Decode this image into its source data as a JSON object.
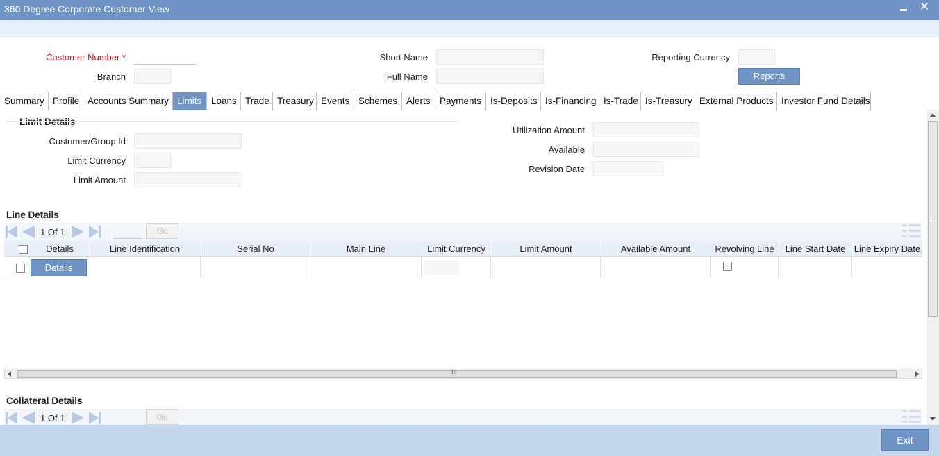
{
  "window": {
    "title": "360 Degree Corporate Customer View",
    "minimize_icon": "minimize-icon",
    "close_icon": "close-icon",
    "close_glyph": "✕"
  },
  "header": {
    "customer_number_label": "Customer Number",
    "required_mark": "*",
    "customer_number_value": "",
    "branch_label": "Branch",
    "branch_value": "",
    "short_name_label": "Short Name",
    "short_name_value": "",
    "full_name_label": "Full Name",
    "full_name_value": "",
    "reporting_currency_label": "Reporting Currency",
    "reporting_currency_value": "",
    "reports_button": "Reports"
  },
  "tabs": [
    "Summary",
    "Profile",
    "Accounts Summary",
    "Limits",
    "Loans",
    "Trade",
    "Treasury",
    "Events",
    "Schemes",
    "Alerts",
    "Payments",
    "Is-Deposits",
    "Is-Financing",
    "Is-Trade",
    "Is-Treasury",
    "External Products",
    "Investor Fund Details"
  ],
  "active_tab": "Limits",
  "limit_details": {
    "title": "Limit Details",
    "customer_group_id_label": "Customer/Group Id",
    "limit_currency_label": "Limit Currency",
    "limit_amount_label": "Limit Amount",
    "utilization_amount_label": "Utilization Amount",
    "available_label": "Available",
    "revision_date_label": "Revision Date"
  },
  "line_details": {
    "title": "Line Details",
    "pager": {
      "current": "1",
      "of_label": "Of",
      "total": "1",
      "go_label": "Go"
    },
    "columns": [
      "Details",
      "Line Identification",
      "Serial No",
      "Main Line",
      "Limit Currency",
      "Limit Amount",
      "Available Amount",
      "Revolving Line",
      "Line Start Date",
      "Line Expiry Date"
    ],
    "row_details_button": "Details",
    "scroll_grip": "III"
  },
  "collateral_details": {
    "title": "Collateral Details",
    "pager": {
      "current": "1",
      "of_label": "Of",
      "total": "1",
      "go_label": "Go"
    }
  },
  "footer": {
    "exit_button": "Exit"
  },
  "colors": {
    "accent": "#6f93c5",
    "footer_bg": "#c5d7ec",
    "required": "#c4141e"
  }
}
